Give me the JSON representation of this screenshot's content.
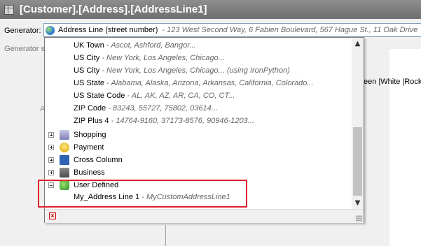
{
  "window": {
    "title": "[Customer].[Address].[AddressLine1]"
  },
  "generator": {
    "label": "Generator:",
    "selected_name": "Address Line (street number)",
    "selected_desc": "- 123 West Second Way, 6 Fabien Boulevard, 567 Hague St., 11 Oak Drive",
    "settings_label": "Generator s"
  },
  "background": {
    "a_fragment": "A",
    "right_text": "een |White |Rock"
  },
  "dropdown": {
    "leaves": [
      {
        "name": "UK Town",
        "desc": " - Ascot, Ashford, Bangor..."
      },
      {
        "name": "US City",
        "desc": " - New York, Los Angeles, Chicago..."
      },
      {
        "name": "US City",
        "desc": " - New York, Los Angeles, Chicago... (using IronPython)"
      },
      {
        "name": "US State",
        "desc": " - Alabama, Alaska, Arizona, Arkansas, California, Colorado..."
      },
      {
        "name": "US State Code",
        "desc": " - AL, AK, AZ, AR, CA, CO, CT..."
      },
      {
        "name": "ZIP Code",
        "desc": " - 83243, 55727, 75802, 03614..."
      },
      {
        "name": "ZIP Plus 4",
        "desc": " - 14764-9160, 37173-8576, 90946-1203..."
      }
    ],
    "categories": [
      {
        "name": "Shopping",
        "icon": "shopping-cart-icon",
        "expanded": false
      },
      {
        "name": "Payment",
        "icon": "coins-icon",
        "expanded": false
      },
      {
        "name": "Cross Column",
        "icon": "cross-column-icon",
        "expanded": false
      },
      {
        "name": "Business",
        "icon": "briefcase-icon",
        "expanded": false
      },
      {
        "name": "User Defined",
        "icon": "puzzle-icon",
        "expanded": true
      }
    ],
    "user_defined_item": {
      "name": "My_Address Line 1",
      "desc": " - MyCustomAddressLine1"
    },
    "scroll_up": "▲",
    "scroll_down": "▼",
    "close_glyph": "x"
  },
  "colors": {
    "highlight": "#e0202a"
  }
}
